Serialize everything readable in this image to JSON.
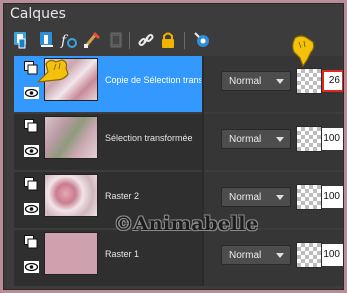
{
  "panel": {
    "title": "Calques"
  },
  "toolbar": {
    "icons": [
      "new-raster-layer-icon",
      "new-vector-layer-icon",
      "fx-effects-icon",
      "edit-brush-icon",
      "mask-icon",
      "link-icon",
      "lock-icon",
      "group-icon"
    ]
  },
  "layers": [
    {
      "name": "Copie de Sélection transformée",
      "blend": "Normal",
      "opacity": "26",
      "selected": true
    },
    {
      "name": "Sélection transformée",
      "blend": "Normal",
      "opacity": "100",
      "selected": false
    },
    {
      "name": "Raster 2",
      "blend": "Normal",
      "opacity": "100",
      "selected": false
    },
    {
      "name": "Raster 1",
      "blend": "Normal",
      "opacity": "100",
      "selected": false
    }
  ],
  "watermark": "©Animabelle",
  "colors": {
    "selected_row": "#3399ff",
    "highlight_border": "#e0281c",
    "panel_bg": "#3c3c3c",
    "page_bg": "#b88d98"
  }
}
